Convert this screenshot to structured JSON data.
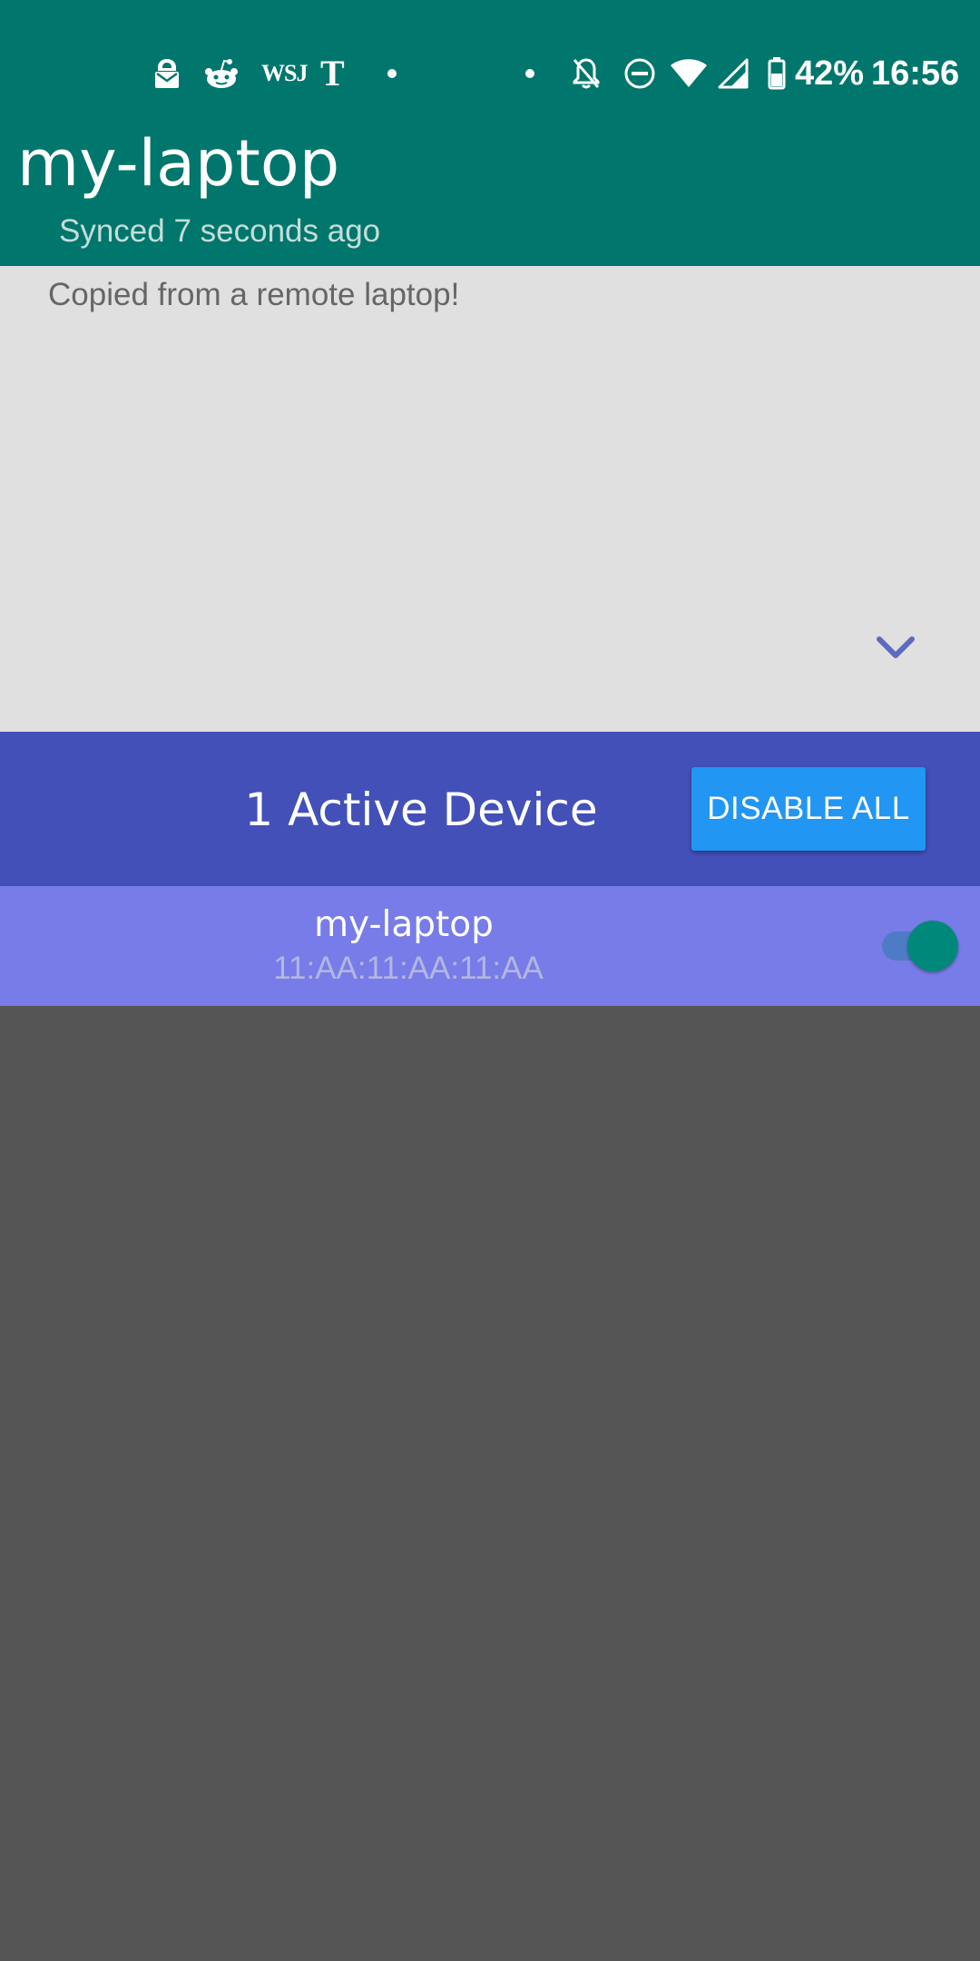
{
  "status_bar": {
    "notification_icons": [
      "mail-lock-icon",
      "reddit-icon",
      "wsj-icon",
      "nyt-icon",
      "dot-icon"
    ],
    "wsj_label": "WSJ",
    "nyt_label": "T",
    "system_icons": [
      "dot-icon",
      "notifications-off-icon",
      "do-not-disturb-icon",
      "wifi-icon",
      "cellular-signal-icon",
      "battery-icon"
    ],
    "battery_percent": "42%",
    "time": "16:56"
  },
  "header": {
    "title": "my-laptop",
    "sync_status": "Synced 7 seconds ago"
  },
  "clipboard": {
    "content": "Copied from a remote laptop!",
    "expand_icon": "chevron-down-icon"
  },
  "devices": {
    "count_label": "1 Active Device",
    "disable_all_label": "DISABLE ALL",
    "items": [
      {
        "name": "my-laptop",
        "address": "11:AA:11:AA:11:AA",
        "enabled": true
      }
    ]
  },
  "colors": {
    "header_bg": "#00766C",
    "clipboard_bg": "#E0E0E0",
    "devices_header_bg": "#4250B8",
    "disable_all_bg": "#2196F3",
    "device_row_bg": "#777CE8",
    "toggle_thumb": "#00897B",
    "empty_bg": "#555555",
    "chevron": "#5C6BC0"
  }
}
